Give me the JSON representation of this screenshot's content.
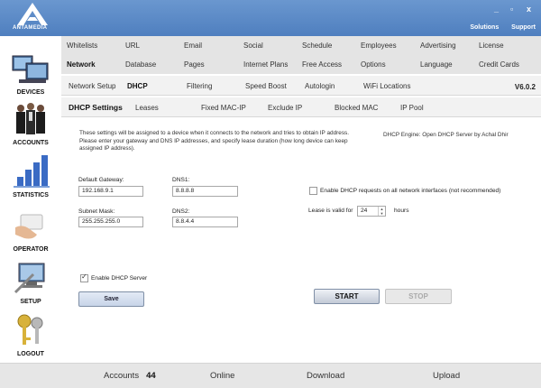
{
  "app": {
    "logo_text": "ANTAMEDIA",
    "window_controls": [
      "_",
      "▫",
      "x"
    ],
    "top_links": [
      "Solutions",
      "Support"
    ],
    "version": "V6.0.2"
  },
  "sidebar": {
    "items": [
      {
        "label": "DEVICES",
        "icon": "monitors-icon"
      },
      {
        "label": "ACCOUNTS",
        "icon": "people-icon"
      },
      {
        "label": "STATISTICS",
        "icon": "bar-chart-icon"
      },
      {
        "label": "OPERATOR",
        "icon": "card-hand-icon"
      },
      {
        "label": "SETUP",
        "icon": "setup-icon"
      },
      {
        "label": "LOGOUT",
        "icon": "keys-icon"
      }
    ]
  },
  "nav": {
    "row1": [
      "Whitelists",
      "URL",
      "Email",
      "Social",
      "Schedule",
      "Employees",
      "Advertising",
      "License"
    ],
    "row2": [
      "Network",
      "Database",
      "Pages",
      "Internet Plans",
      "Free Access",
      "Options",
      "Language",
      "Credit Cards"
    ],
    "active_main": "Network",
    "network_tabs": [
      "Network Setup",
      "DHCP",
      "Filtering",
      "Speed Boost",
      "Autologin",
      "WiFi Locations"
    ],
    "active_network": "DHCP",
    "dhcp_tabs": [
      "DHCP Settings",
      "Leases",
      "Fixed MAC-IP",
      "Exclude IP",
      "Blocked MAC",
      "IP Pool"
    ],
    "active_dhcp": "DHCP Settings"
  },
  "content": {
    "description": "These settings will be assigned to a device when it connects to the network and tries to obtain IP address. Please enter your gateway and DNS IP addresses, and specify lease duration (how long device can keep assigned IP address).",
    "engine": "DHCP Engine: Open DHCP Server by Achal Dhir",
    "gateway_label": "Default Gateway:",
    "gateway_value": "192.168.9.1",
    "dns1_label": "DNS1:",
    "dns1_value": "8.8.8.8",
    "subnet_label": "Subnet Mask:",
    "subnet_value": "255.255.255.0",
    "dns2_label": "DNS2:",
    "dns2_value": "8.8.4.4",
    "all_interfaces_label": "Enable DHCP requests on all network interfaces (not recommended)",
    "all_interfaces_checked": false,
    "lease_label": "Lease is valid for",
    "lease_value": "24",
    "lease_unit": "hours",
    "enable_label": "Enable DHCP Server",
    "enable_checked": true,
    "save_label": "Save",
    "start_label": "START",
    "stop_label": "STOP"
  },
  "footer": {
    "accounts_label": "Accounts",
    "accounts_count": "44",
    "online_label": "Online",
    "download_label": "Download",
    "upload_label": "Upload"
  },
  "colors": {
    "titlebar": "#5b88c6",
    "button_blue": "#c7d4e8"
  }
}
